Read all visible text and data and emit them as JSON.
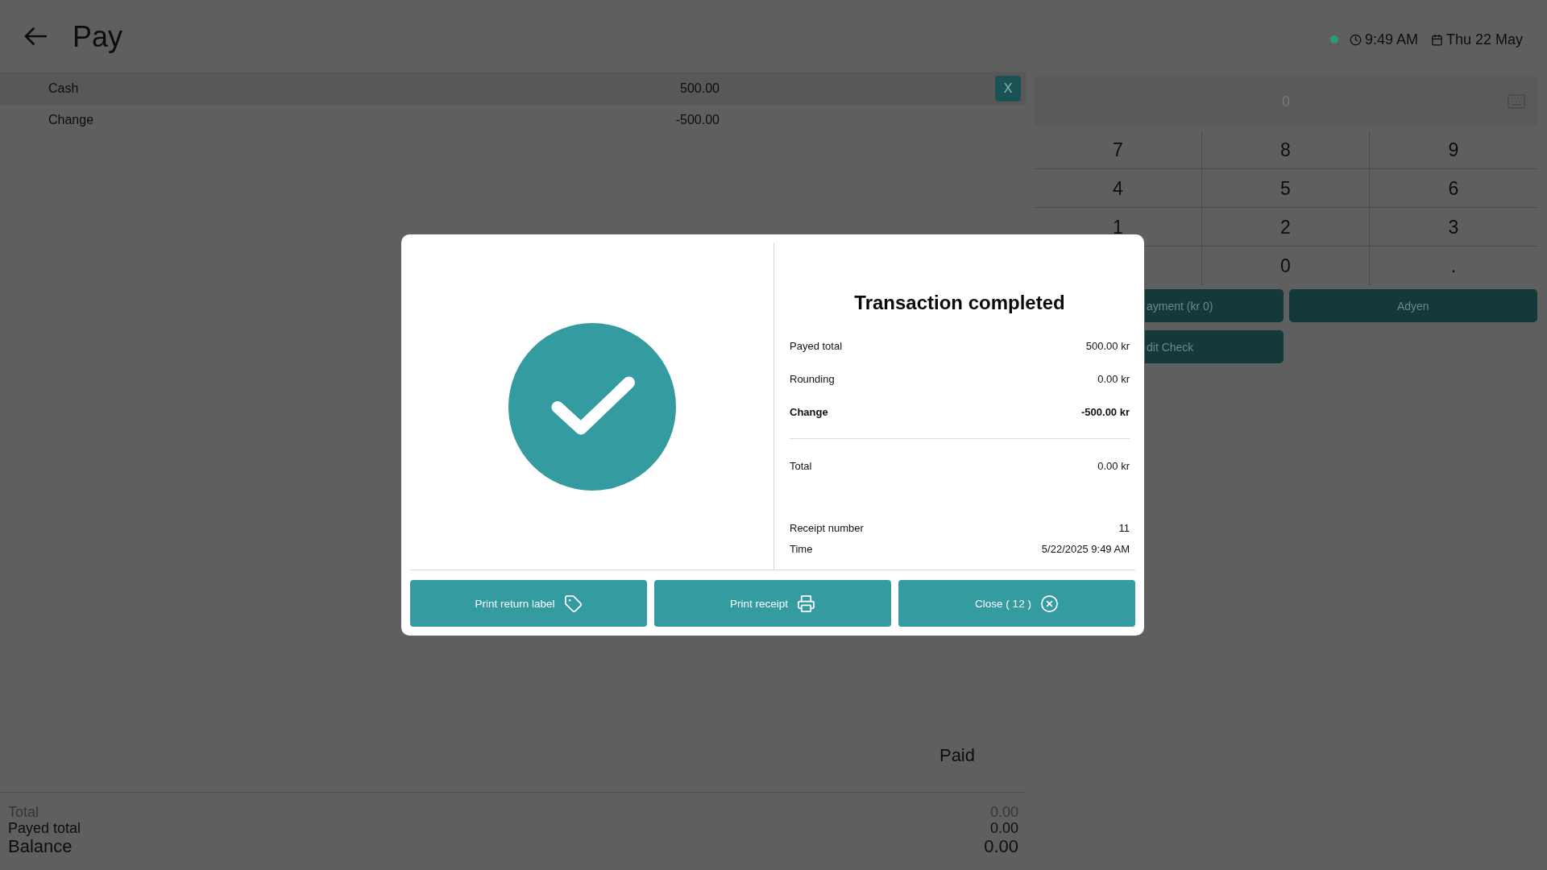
{
  "header": {
    "title": "Pay",
    "time": "9:49 AM",
    "date": "Thu 22 May"
  },
  "payments": [
    {
      "method": "Cash",
      "amount": "500.00",
      "remove_label": "X"
    }
  ],
  "change": {
    "label": "Change",
    "amount": "-500.00"
  },
  "keypad": {
    "display": {
      "placeholder": "0"
    },
    "rows": [
      [
        "7",
        "8",
        "9"
      ],
      [
        "4",
        "5",
        "6"
      ],
      [
        "1",
        "2",
        "3"
      ],
      [
        "",
        "0",
        "."
      ]
    ]
  },
  "actions": [
    {
      "label": "ayment (kr 0)"
    },
    {
      "label": "Adyen"
    },
    {
      "label": "dit Check"
    }
  ],
  "paid": {
    "heading": "Paid",
    "rows": [
      {
        "label": "Total",
        "value": "0.00",
        "kind": "muted"
      },
      {
        "label": "Payed total",
        "value": "0.00",
        "kind": "normal"
      },
      {
        "label": "Balance",
        "value": "0.00",
        "kind": "large"
      }
    ]
  },
  "dialog": {
    "title": "Transaction completed",
    "amounts": [
      {
        "label": "Payed total",
        "value": "500.00 kr",
        "emphasized": false
      },
      {
        "label": "Rounding",
        "value": "0.00 kr",
        "emphasized": false
      },
      {
        "label": "Change",
        "value": "-500.00 kr",
        "emphasized": true
      }
    ],
    "total": {
      "label": "Total",
      "value": "0.00 kr"
    },
    "receipt": [
      {
        "label": "Receipt number",
        "value": "11"
      },
      {
        "label": "Time",
        "value": "5/22/2025 9:49 AM"
      }
    ],
    "buttons": [
      {
        "kind": "return_label",
        "label": "Print return label"
      },
      {
        "kind": "print",
        "label": "Print receipt"
      },
      {
        "kind": "close",
        "label": "Close ( 12 )"
      }
    ]
  }
}
